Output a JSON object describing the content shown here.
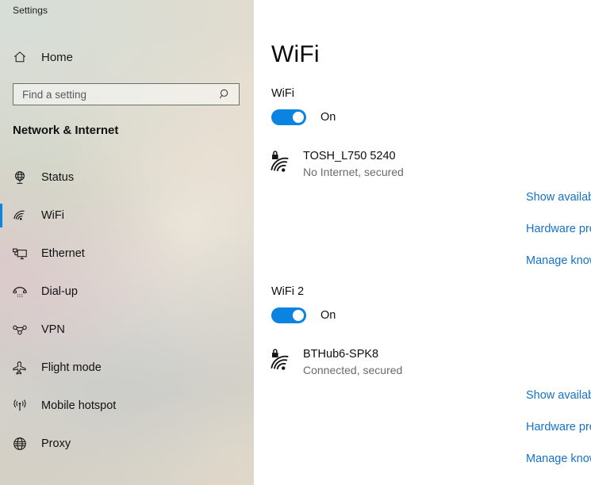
{
  "app": {
    "title": "Settings"
  },
  "sidebar": {
    "home_label": "Home",
    "home_icon": "home-icon",
    "search": {
      "placeholder": "Find a setting",
      "value": "",
      "icon": "search-icon"
    },
    "section_title": "Network & Internet",
    "items": [
      {
        "label": "Status",
        "icon": "status-globe-monitor-icon",
        "selected": false
      },
      {
        "label": "WiFi",
        "icon": "wifi-icon",
        "selected": true
      },
      {
        "label": "Ethernet",
        "icon": "ethernet-icon",
        "selected": false
      },
      {
        "label": "Dial-up",
        "icon": "dialup-phone-icon",
        "selected": false
      },
      {
        "label": "VPN",
        "icon": "vpn-icon",
        "selected": false
      },
      {
        "label": "Flight mode",
        "icon": "airplane-icon",
        "selected": false
      },
      {
        "label": "Mobile hotspot",
        "icon": "broadcast-antenna-icon",
        "selected": false
      },
      {
        "label": "Proxy",
        "icon": "globe-icon",
        "selected": false
      }
    ]
  },
  "main": {
    "page_title": "WiFi",
    "adapters": [
      {
        "label": "WiFi",
        "toggle_state": "On",
        "toggle_on": true,
        "network_name": "TOSH_L750 5240",
        "network_status": "No Internet, secured",
        "network_icon": "wifi-secured-icon",
        "links": [
          "Show available networks",
          "Hardware properties",
          "Manage known networks"
        ]
      },
      {
        "label": "WiFi 2",
        "toggle_state": "On",
        "toggle_on": true,
        "network_name": "BTHub6-SPK8",
        "network_status": "Connected, secured",
        "network_icon": "wifi-secured-icon",
        "links": [
          "Show available networks",
          "Hardware properties",
          "Manage known networks"
        ]
      }
    ]
  },
  "colors": {
    "accent": "#0a84e0",
    "link": "#1572c4",
    "text": "#111111",
    "muted_text": "#6a6a6a",
    "main_bg": "#ffffff"
  }
}
